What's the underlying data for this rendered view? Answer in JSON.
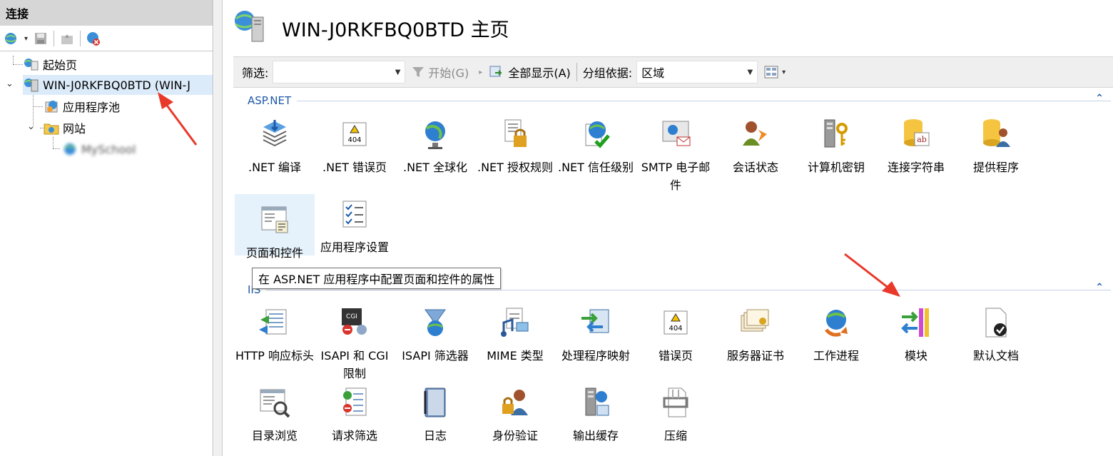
{
  "connections": {
    "title": "连接",
    "tree": {
      "start_page": "起始页",
      "server": "WIN-J0RKFBQ0BTD (WIN-J",
      "app_pools": "应用程序池",
      "sites": "网站",
      "site_child": "MySchool"
    }
  },
  "main": {
    "page_title": "WIN-J0RKFBQ0BTD 主页",
    "filterbar": {
      "filter_label": "筛选:",
      "filter_value": "",
      "start_button": "开始(G)",
      "show_all_button": "全部显示(A)",
      "group_by_label": "分组依据:",
      "group_by_value": "区域"
    },
    "groups": {
      "aspnet": {
        "title": "ASP.NET",
        "items": [
          {
            "label": ".NET 编译",
            "icon": "compile-icon"
          },
          {
            "label": ".NET 错误页",
            "icon": "error-page-404-icon"
          },
          {
            "label": ".NET 全球化",
            "icon": "globe-icon"
          },
          {
            "label": ".NET 授权规则",
            "icon": "lock-document-icon"
          },
          {
            "label": ".NET 信任级别",
            "icon": "trust-globe-check-icon"
          },
          {
            "label": "SMTP 电子邮件",
            "icon": "email-icon"
          },
          {
            "label": "会话状态",
            "icon": "session-user-icon"
          },
          {
            "label": "计算机密钥",
            "icon": "machine-key-icon"
          },
          {
            "label": "连接字符串",
            "icon": "connection-string-icon"
          },
          {
            "label": "提供程序",
            "icon": "providers-icon"
          },
          {
            "label": "页面和控件",
            "icon": "pages-controls-icon"
          },
          {
            "label": "应用程序设置",
            "icon": "app-settings-icon"
          }
        ]
      },
      "iis": {
        "title": "IIS",
        "items": [
          {
            "label": "HTTP 响应标头",
            "icon": "http-headers-icon"
          },
          {
            "label": "ISAPI 和 CGI 限制",
            "icon": "isapi-cgi-icon"
          },
          {
            "label": "ISAPI 筛选器",
            "icon": "isapi-filter-icon"
          },
          {
            "label": "MIME 类型",
            "icon": "mime-icon"
          },
          {
            "label": "处理程序映射",
            "icon": "handler-mapping-icon"
          },
          {
            "label": "错误页",
            "icon": "error-page-icon"
          },
          {
            "label": "服务器证书",
            "icon": "certificate-icon"
          },
          {
            "label": "工作进程",
            "icon": "worker-process-icon"
          },
          {
            "label": "模块",
            "icon": "modules-icon"
          },
          {
            "label": "默认文档",
            "icon": "default-document-icon"
          },
          {
            "label": "目录浏览",
            "icon": "directory-browsing-icon"
          },
          {
            "label": "请求筛选",
            "icon": "request-filtering-icon"
          },
          {
            "label": "日志",
            "icon": "logging-icon"
          },
          {
            "label": "身份验证",
            "icon": "authentication-icon"
          },
          {
            "label": "输出缓存",
            "icon": "output-caching-icon"
          },
          {
            "label": "压缩",
            "icon": "compression-icon"
          }
        ]
      }
    },
    "tooltip": "在 ASP.NET 应用程序中配置页面和控件的属性"
  },
  "colors": {
    "accent": "#1e5aa8",
    "selection": "#dcebfa",
    "annotation_arrow": "#e8392b"
  }
}
